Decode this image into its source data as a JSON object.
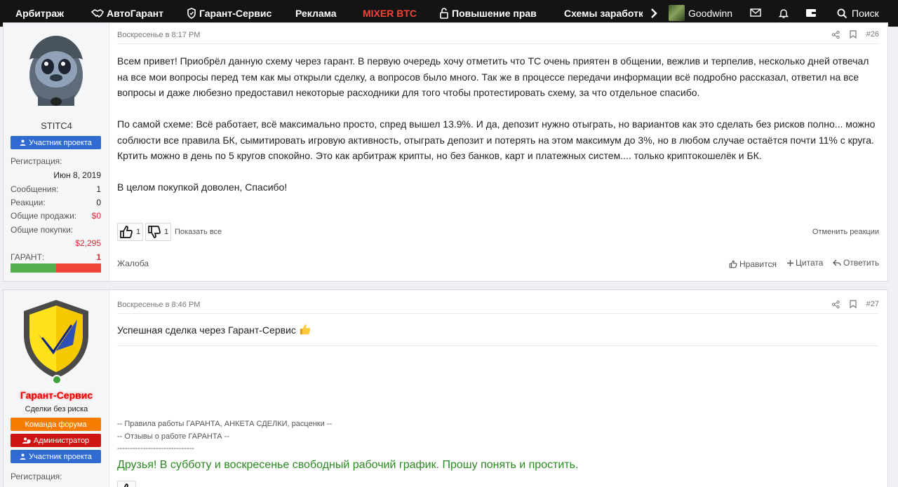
{
  "nav": {
    "items": [
      "Арбитраж",
      "АвтоГарант",
      "Гарант-Сервис",
      "Реклама",
      "MIXER BTC",
      "Повышение прав",
      "Схемы заработка"
    ],
    "username": "Goodwinn",
    "search_label": "Поиск"
  },
  "posts": [
    {
      "author": "STITC4",
      "badges": [
        "Участник проекта"
      ],
      "stats": {
        "reg_label": "Регистрация:",
        "reg_value": "Июн 8, 2019",
        "messages_label": "Сообщения:",
        "messages_value": "1",
        "reactions_label": "Реакции:",
        "reactions_value": "0",
        "sales_label": "Общие продажи:",
        "sales_value": "$0",
        "purchases_label": "Общие покупки:",
        "purchases_value": "$2,295",
        "guarant_label": "ГАРАНТ:",
        "guarant_value": "1",
        "rep_positive_fraction": 0.5
      },
      "date": "Воскресенье в 8:17 PM",
      "number": "#26",
      "paragraphs": [
        "Всем привет! Приобрёл данную схему через гарант. В первую очередь хочу отметить что ТС очень приятен в общении, вежлив и терпелив, несколько дней отвечал на все мои вопросы перед тем как мы открыли сделку, а вопросов было много. Так же в процессе передачи информации всё подробно рассказал, ответил на все вопросы и даже любезно предоставил некоторые расходники для того чтобы протестировать схему, за что отдельное спасибо.",
        "По самой схеме: Всё работает, всё максимально просто, спред вышел 13.9%. И да, депозит нужно отыграть, но вариантов как это сделать без рисков полно... можно соблюсти все правила БК, сымитировать игровую активность, отыграть депозит и потерять на этом максимум до 3%, но в любом случае остаётся почти 11% с круга. Кртить можно в день по 5 кругов спокойно. Это как арбитраж крипты, но без банков, карт и платежных систем.... только криптокошелёк и БК.",
        "В целом покупкой доволен, Спасибо!"
      ],
      "likes": "1",
      "dislikes": "1",
      "show_all": "Показать все",
      "undo_reaction": "Отменить реакции",
      "report": "Жалоба",
      "like_action": "Нравится",
      "quote_action": "Цитата",
      "reply_action": "Ответить"
    },
    {
      "author": "Гарант-Сервис",
      "user_title": "Сделки без риска",
      "badges": [
        "Команда форума",
        "Администратор",
        "Участник проекта"
      ],
      "reg_label": "Регистрация:",
      "date": "Воскресенье в 8:46 PM",
      "number": "#27",
      "text": "Успешная сделка через Гарант-Сервис",
      "signature": {
        "line1": "-- Правила работы ГАРАНТА, АНКЕТА СДЕЛКИ, расценки --",
        "line2": "-- Отзывы о работе ГАРАНТА --",
        "line3": "------------------------------",
        "notice": "Друзья! В субботу и воскресенье свободный рабочий график. Прошу понять и простить."
      }
    }
  ],
  "colors": {
    "topbar": "#141414",
    "mixer": "#f44336",
    "badge_blue": "#2f6bd1",
    "badge_orange": "#f57c00",
    "badge_red": "#cf1414",
    "notice_green": "#2a8a1f"
  }
}
